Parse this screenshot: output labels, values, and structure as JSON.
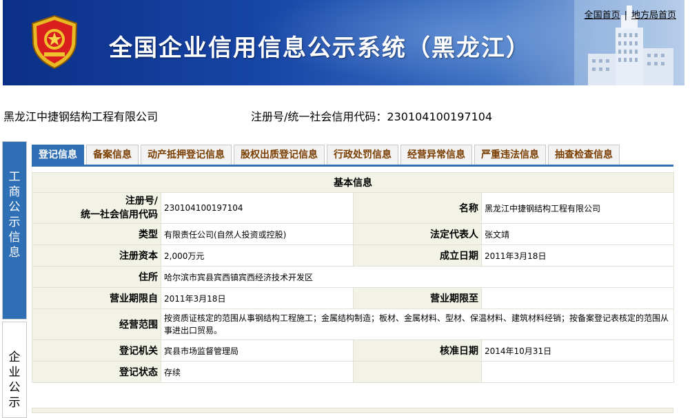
{
  "header": {
    "title": "全国企业信用信息公示系统（黑龙江）",
    "links": [
      "全国首页",
      "地方局首页"
    ],
    "colors": {
      "banner": "#1847a8",
      "title": "#ffffff"
    }
  },
  "company": {
    "name": "黑龙江中捷钢结构工程有限公司",
    "reg_label": "注册号/统一社会信用代码：",
    "reg_no": "230104100197104"
  },
  "side_nav": [
    {
      "label": "工商公示信息",
      "active": true
    },
    {
      "label": "企业公示",
      "active": false
    }
  ],
  "tabs": [
    "登记信息",
    "备案信息",
    "动产抵押登记信息",
    "股权出质登记信息",
    "行政处罚信息",
    "经营异常信息",
    "严重违法信息",
    "抽查检查信息"
  ],
  "active_tab": "登记信息",
  "basic_info": {
    "heading": "基本信息",
    "reg_label_1": "注册号/",
    "reg_label_2": "统一社会信用代码",
    "reg_no": "230104100197104",
    "name_label": "名称",
    "name": "黑龙江中捷钢结构工程有限公司",
    "type_label": "类型",
    "type": "有限责任公司(自然人投资或控股)",
    "legal_rep_label": "法定代表人",
    "legal_rep": "张文靖",
    "capital_label": "注册资本",
    "capital": "2,000万元",
    "est_date_label": "成立日期",
    "est_date": "2011年3月18日",
    "address_label": "住所",
    "address": "哈尔滨市宾县宾西镇宾西经济技术开发区",
    "term_from_label": "营业期限自",
    "term_from": "2011年3月18日",
    "term_to_label": "营业期限至",
    "term_to": "",
    "scope_label": "经营范围",
    "scope": "按资质证核定的范围从事钢结构工程施工；金属结构制造；板材、金属材料、型材、保温材料、建筑材料经销；按备案登记表核定的范围从事进出口贸易。",
    "authority_label": "登记机关",
    "authority": "宾县市场监督管理局",
    "approval_date_label": "核准日期",
    "approval_date": "2014年10月31日",
    "status_label": "登记状态",
    "status": "存续"
  }
}
